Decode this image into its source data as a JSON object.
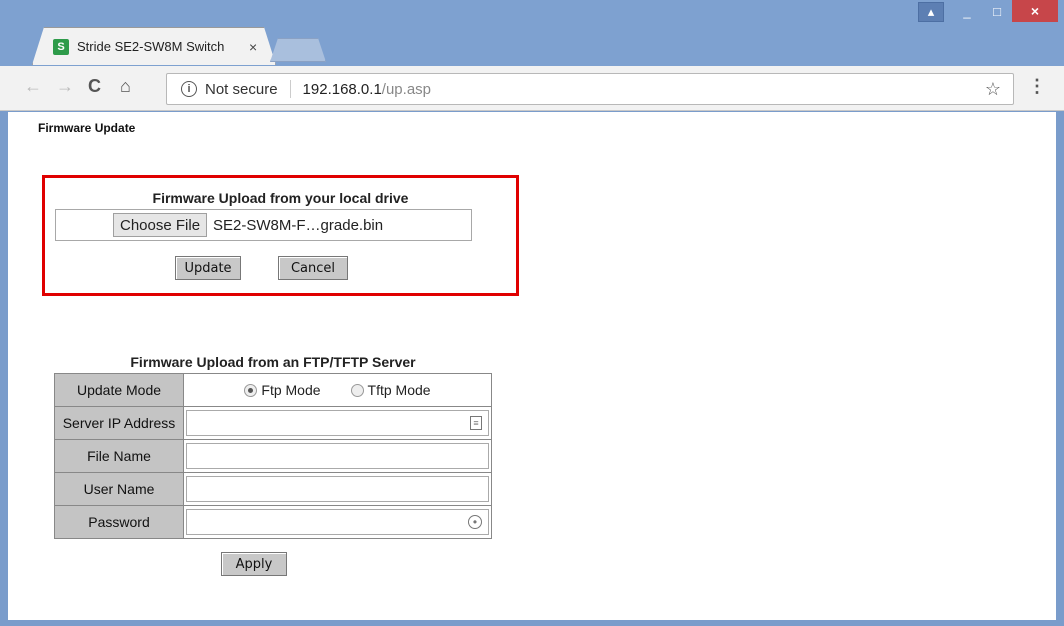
{
  "window": {
    "profile_icon": "person-icon",
    "minimize": "_",
    "maximize": "□",
    "close": "×"
  },
  "tab": {
    "favicon_letter": "S",
    "title": "Stride SE2-SW8M Switch",
    "close": "×"
  },
  "toolbar": {
    "back": "←",
    "forward": "→",
    "reload": "C",
    "home": "⌂",
    "security_label": "Not secure",
    "url_host": "192.168.0.1",
    "url_path": "/up.asp",
    "star": "☆",
    "menu": "⋮"
  },
  "page": {
    "title": "Firmware Update",
    "local": {
      "heading": "Firmware Upload from your local drive",
      "choose_label": "Choose File",
      "file_name": "SE2-SW8M-F…grade.bin",
      "update_label": "Update",
      "cancel_label": "Cancel"
    },
    "ftp": {
      "heading": "Firmware Upload from an FTP/TFTP Server",
      "rows": {
        "mode": "Update Mode",
        "ip": "Server IP Address",
        "file": "File Name",
        "user": "User Name",
        "password": "Password"
      },
      "ftp_mode": "Ftp Mode",
      "tftp_mode": "Tftp Mode",
      "selected_mode": "Ftp Mode",
      "server_ip": "",
      "file_name": "",
      "user_name": "",
      "password": "",
      "apply_label": "Apply"
    }
  },
  "colors": {
    "highlight_border": "#e00000",
    "label_bg": "#c4c4c4",
    "frame": "#7ea1d0"
  }
}
